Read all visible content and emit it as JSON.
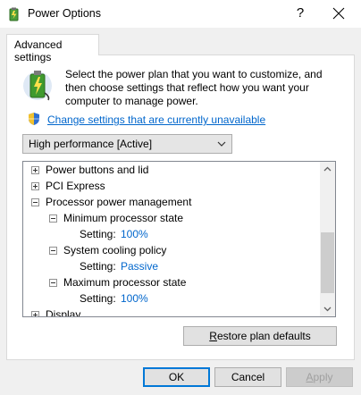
{
  "window": {
    "title": "Power Options",
    "help_glyph": "?"
  },
  "tabs": [
    {
      "label": "Advanced settings"
    }
  ],
  "intro_text": "Select the power plan that you want to customize, and then choose settings that reflect how you want your computer to manage power.",
  "change_link": "Change settings that are currently unavailable",
  "plan_select": {
    "value": "High performance [Active]"
  },
  "tree": {
    "rows": [
      {
        "label": "Power buttons and lid",
        "expander": "plus"
      },
      {
        "label": "PCI Express",
        "expander": "plus"
      },
      {
        "label": "Processor power management",
        "expander": "minus"
      },
      {
        "label": "Minimum processor state",
        "expander": "minus"
      },
      {
        "label": "Setting:",
        "value": "100%"
      },
      {
        "label": "System cooling policy",
        "expander": "minus"
      },
      {
        "label": "Setting:",
        "value": "Passive"
      },
      {
        "label": "Maximum processor state",
        "expander": "minus"
      },
      {
        "label": "Setting:",
        "value": "100%"
      },
      {
        "label": "Display",
        "expander": "plus"
      }
    ]
  },
  "buttons": {
    "restore": {
      "pre": "",
      "accel": "R",
      "post": "estore plan defaults"
    },
    "ok": "OK",
    "cancel": "Cancel",
    "apply": {
      "accel": "A",
      "post": "pply"
    }
  },
  "colors": {
    "link": "#0066cc",
    "focus_border": "#0078d7"
  }
}
